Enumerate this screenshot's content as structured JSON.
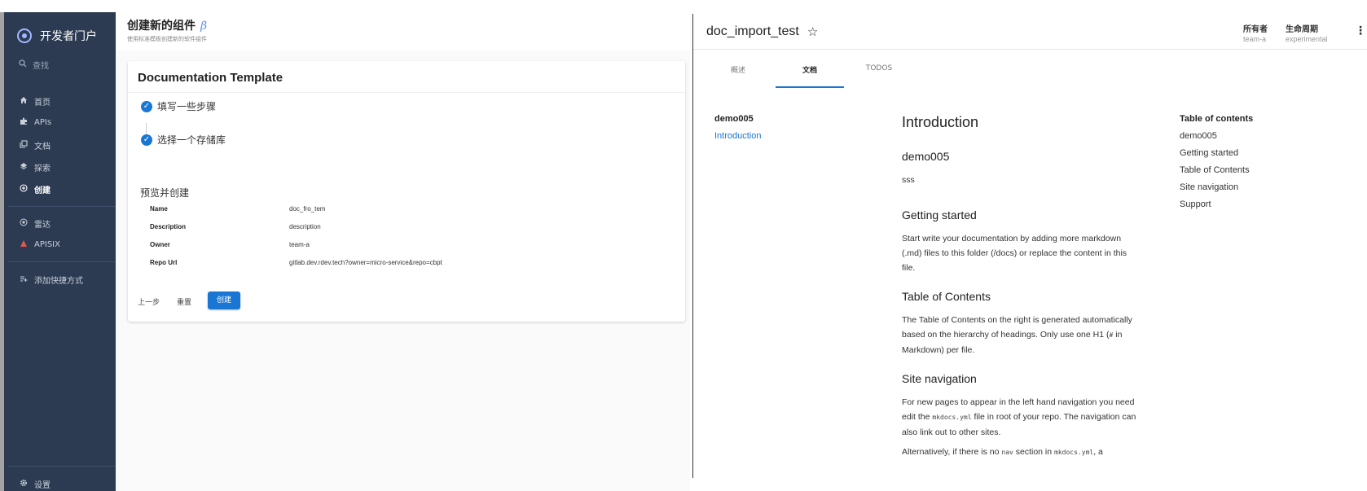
{
  "sidebar": {
    "app_title": "开发者门户",
    "search_label": "查找",
    "items": [
      {
        "label": "首页",
        "icon": "home-icon"
      },
      {
        "label": "APIs",
        "icon": "puzzle-icon"
      },
      {
        "label": "文档",
        "icon": "library-icon"
      },
      {
        "label": "探索",
        "icon": "layers-icon"
      },
      {
        "label": "创建",
        "icon": "add-circle-icon"
      },
      {
        "label": "雷达",
        "icon": "radar-icon"
      },
      {
        "label": "APISIX",
        "icon": "apisix-icon"
      },
      {
        "label": "添加快捷方式",
        "icon": "playlist-add-icon"
      }
    ],
    "settings_label": "设置"
  },
  "create": {
    "title": "创建新的组件",
    "beta": "β",
    "subtitle": "使用标准模板创建新的软件组件",
    "card_title": "Documentation Template",
    "steps": [
      "填写一些步骤",
      "选择一个存储库"
    ],
    "preview_title": "预览并创建",
    "review": [
      {
        "label": "Name",
        "value": "doc_fro_tem"
      },
      {
        "label": "Description",
        "value": "description"
      },
      {
        "label": "Owner",
        "value": "team-a"
      },
      {
        "label": "Repo Url",
        "value": "gitlab.dev.rdev.tech?owner=micro-service&repo=cbpt"
      }
    ],
    "back_label": "上一步",
    "reset_label": "重置",
    "create_label": "创建"
  },
  "entity": {
    "title": "doc_import_test",
    "owner_key": "所有者",
    "owner_value": "team-a",
    "lifecycle_key": "生命周期",
    "lifecycle_value": "experimental",
    "tabs": [
      "概述",
      "文档",
      "TODOS"
    ],
    "active_tab": "文档"
  },
  "docs": {
    "nav_title": "demo005",
    "nav_link": "Introduction",
    "h1": "Introduction",
    "h_demo": "demo005",
    "p_demo": "sss",
    "h_getting_started": "Getting started",
    "p_getting_started": "Start write your documentation by adding more markdown (.md) files to this folder (/docs) or replace the content in this file.",
    "h_toc": "Table of Contents",
    "p_toc_1": "The Table of Contents on the right is generated automatically based on the hierarchy of headings. Only use one H1 (",
    "p_toc_code": "#",
    "p_toc_2": " in Markdown) per file.",
    "h_site_nav": "Site navigation",
    "p_nav_1": "For new pages to appear in the left hand navigation you need edit the ",
    "p_nav_code": "mkdocs.yml",
    "p_nav_2": " file in root of your repo. The navigation can also link out to other sites.",
    "p_alt_1": "Alternatively, if there is no ",
    "p_alt_code1": "nav",
    "p_alt_2": " section in ",
    "p_alt_code2": "mkdocs.yml",
    "p_alt_3": ", a",
    "toc_title": "Table of contents",
    "toc_items": [
      "demo005",
      "Getting started",
      "Table of Contents",
      "Site navigation",
      "Support"
    ]
  },
  "colors": {
    "sidebar_bg": "#2c3b52",
    "accent": "#1976d2"
  }
}
